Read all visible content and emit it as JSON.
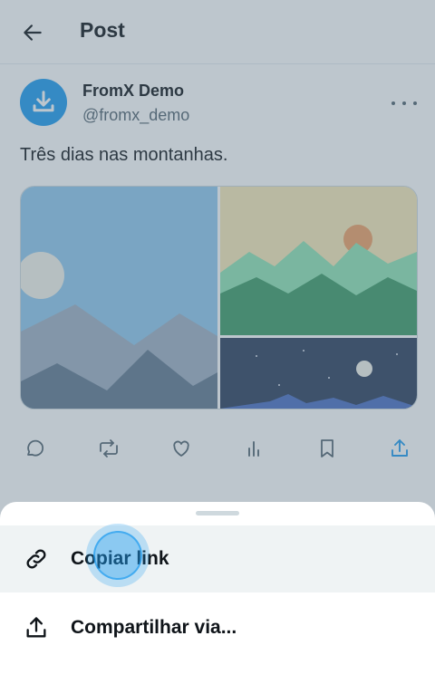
{
  "header": {
    "title": "Post"
  },
  "post": {
    "author_name": "FromX Demo",
    "author_handle": "@fromx_demo",
    "text": "Três dias nas montanhas."
  },
  "colors": {
    "accent": "#1d9bf0",
    "text": "#0f1419",
    "muted": "#536471",
    "sheet_highlight": "#eff3f4"
  },
  "icons": {
    "back": "arrow-left-icon",
    "avatar": "download-icon",
    "more": "more-horizontal-icon",
    "actions": [
      "reply-icon",
      "retweet-icon",
      "like-icon",
      "views-icon",
      "bookmark-icon",
      "share-icon"
    ],
    "copy_link": "link-icon",
    "share_via": "share-icon"
  },
  "share_sheet": {
    "options": [
      {
        "label": "Copiar link"
      },
      {
        "label": "Compartilhar via..."
      }
    ]
  }
}
